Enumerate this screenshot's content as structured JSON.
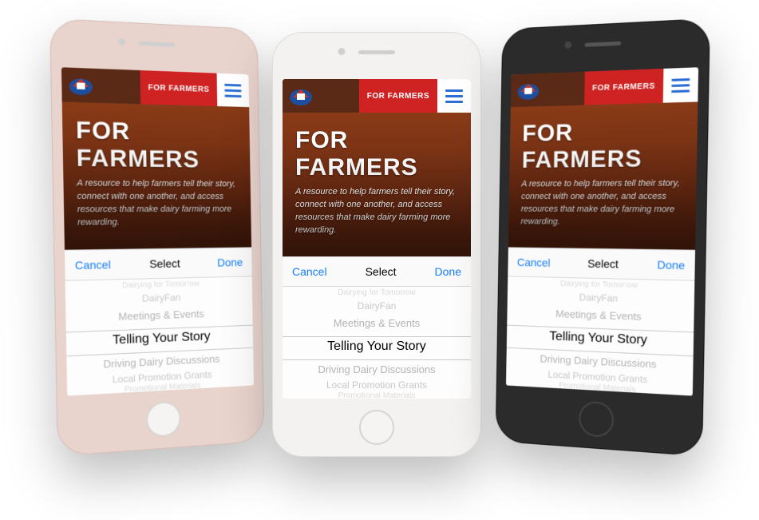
{
  "header": {
    "tab_label": "FOR FARMERS"
  },
  "hero": {
    "title": "FOR FARMERS",
    "subtitle": "A resource to help farmers tell their story, connect with one another, and access resources that make dairy farming more rewarding."
  },
  "picker": {
    "toolbar": {
      "cancel": "Cancel",
      "title": "Select",
      "done": "Done"
    },
    "options": [
      "Dairying for Tomorrow",
      "DairyFan",
      "Meetings & Events",
      "Telling Your Story",
      "Driving Dairy Discussions",
      "Local Promotion Grants",
      "Promotional Materials"
    ],
    "selected_index": 3
  },
  "colors": {
    "brand_red": "#cf2323",
    "brand_brown": "#5a2a16",
    "ios_blue": "#147efb"
  }
}
